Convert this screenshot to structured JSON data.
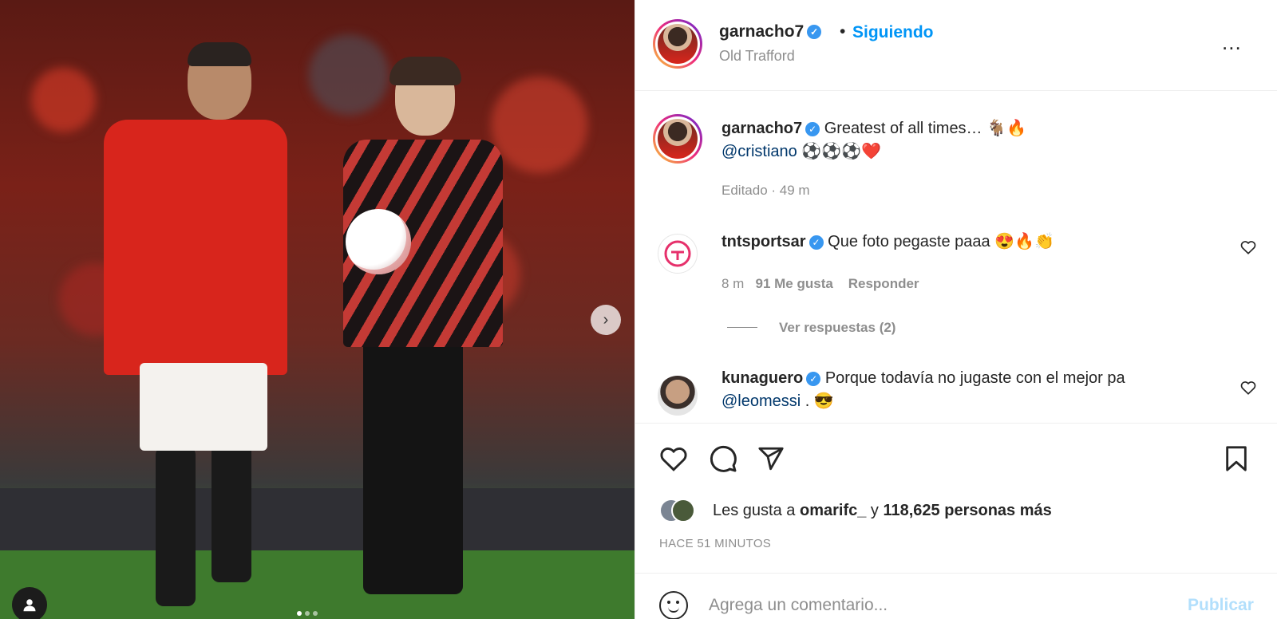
{
  "post": {
    "username": "garnacho7",
    "follow_label": "Siguiendo",
    "separator": "•",
    "location": "Old Trafford",
    "more_label": "..."
  },
  "caption": {
    "username": "garnacho7",
    "text": "Greatest of all times… 🐐🔥",
    "mention": "@cristiano",
    "text2": "⚽⚽⚽❤️",
    "meta": "Editado · 49 m"
  },
  "comments": [
    {
      "username": "tntsportsar",
      "text": "Que foto pegaste paaa 😍🔥👏",
      "time": "8 m",
      "likes": "91 Me gusta",
      "reply_label": "Responder",
      "view_replies": "Ver respuestas (2)"
    },
    {
      "username": "kunaguero",
      "text": "Porque todavía no jugaste con el mejor pa",
      "mention": "@leomessi",
      "suffix": ". 😎"
    }
  ],
  "likes": {
    "prefix": "Les gusta a",
    "user": "omarifc_",
    "connector": "y",
    "count": "118,625 personas más"
  },
  "time_ago": "HACE 51 MINUTOS",
  "composer": {
    "placeholder": "Agrega un comentario...",
    "publish_label": "Publicar"
  },
  "carousel": {
    "next_glyph": "›",
    "total_slides": 3,
    "active_slide": 1
  },
  "colors": {
    "accent": "#0095f6",
    "verified": "#3897f0",
    "publish_disabled": "#b2dffc"
  }
}
